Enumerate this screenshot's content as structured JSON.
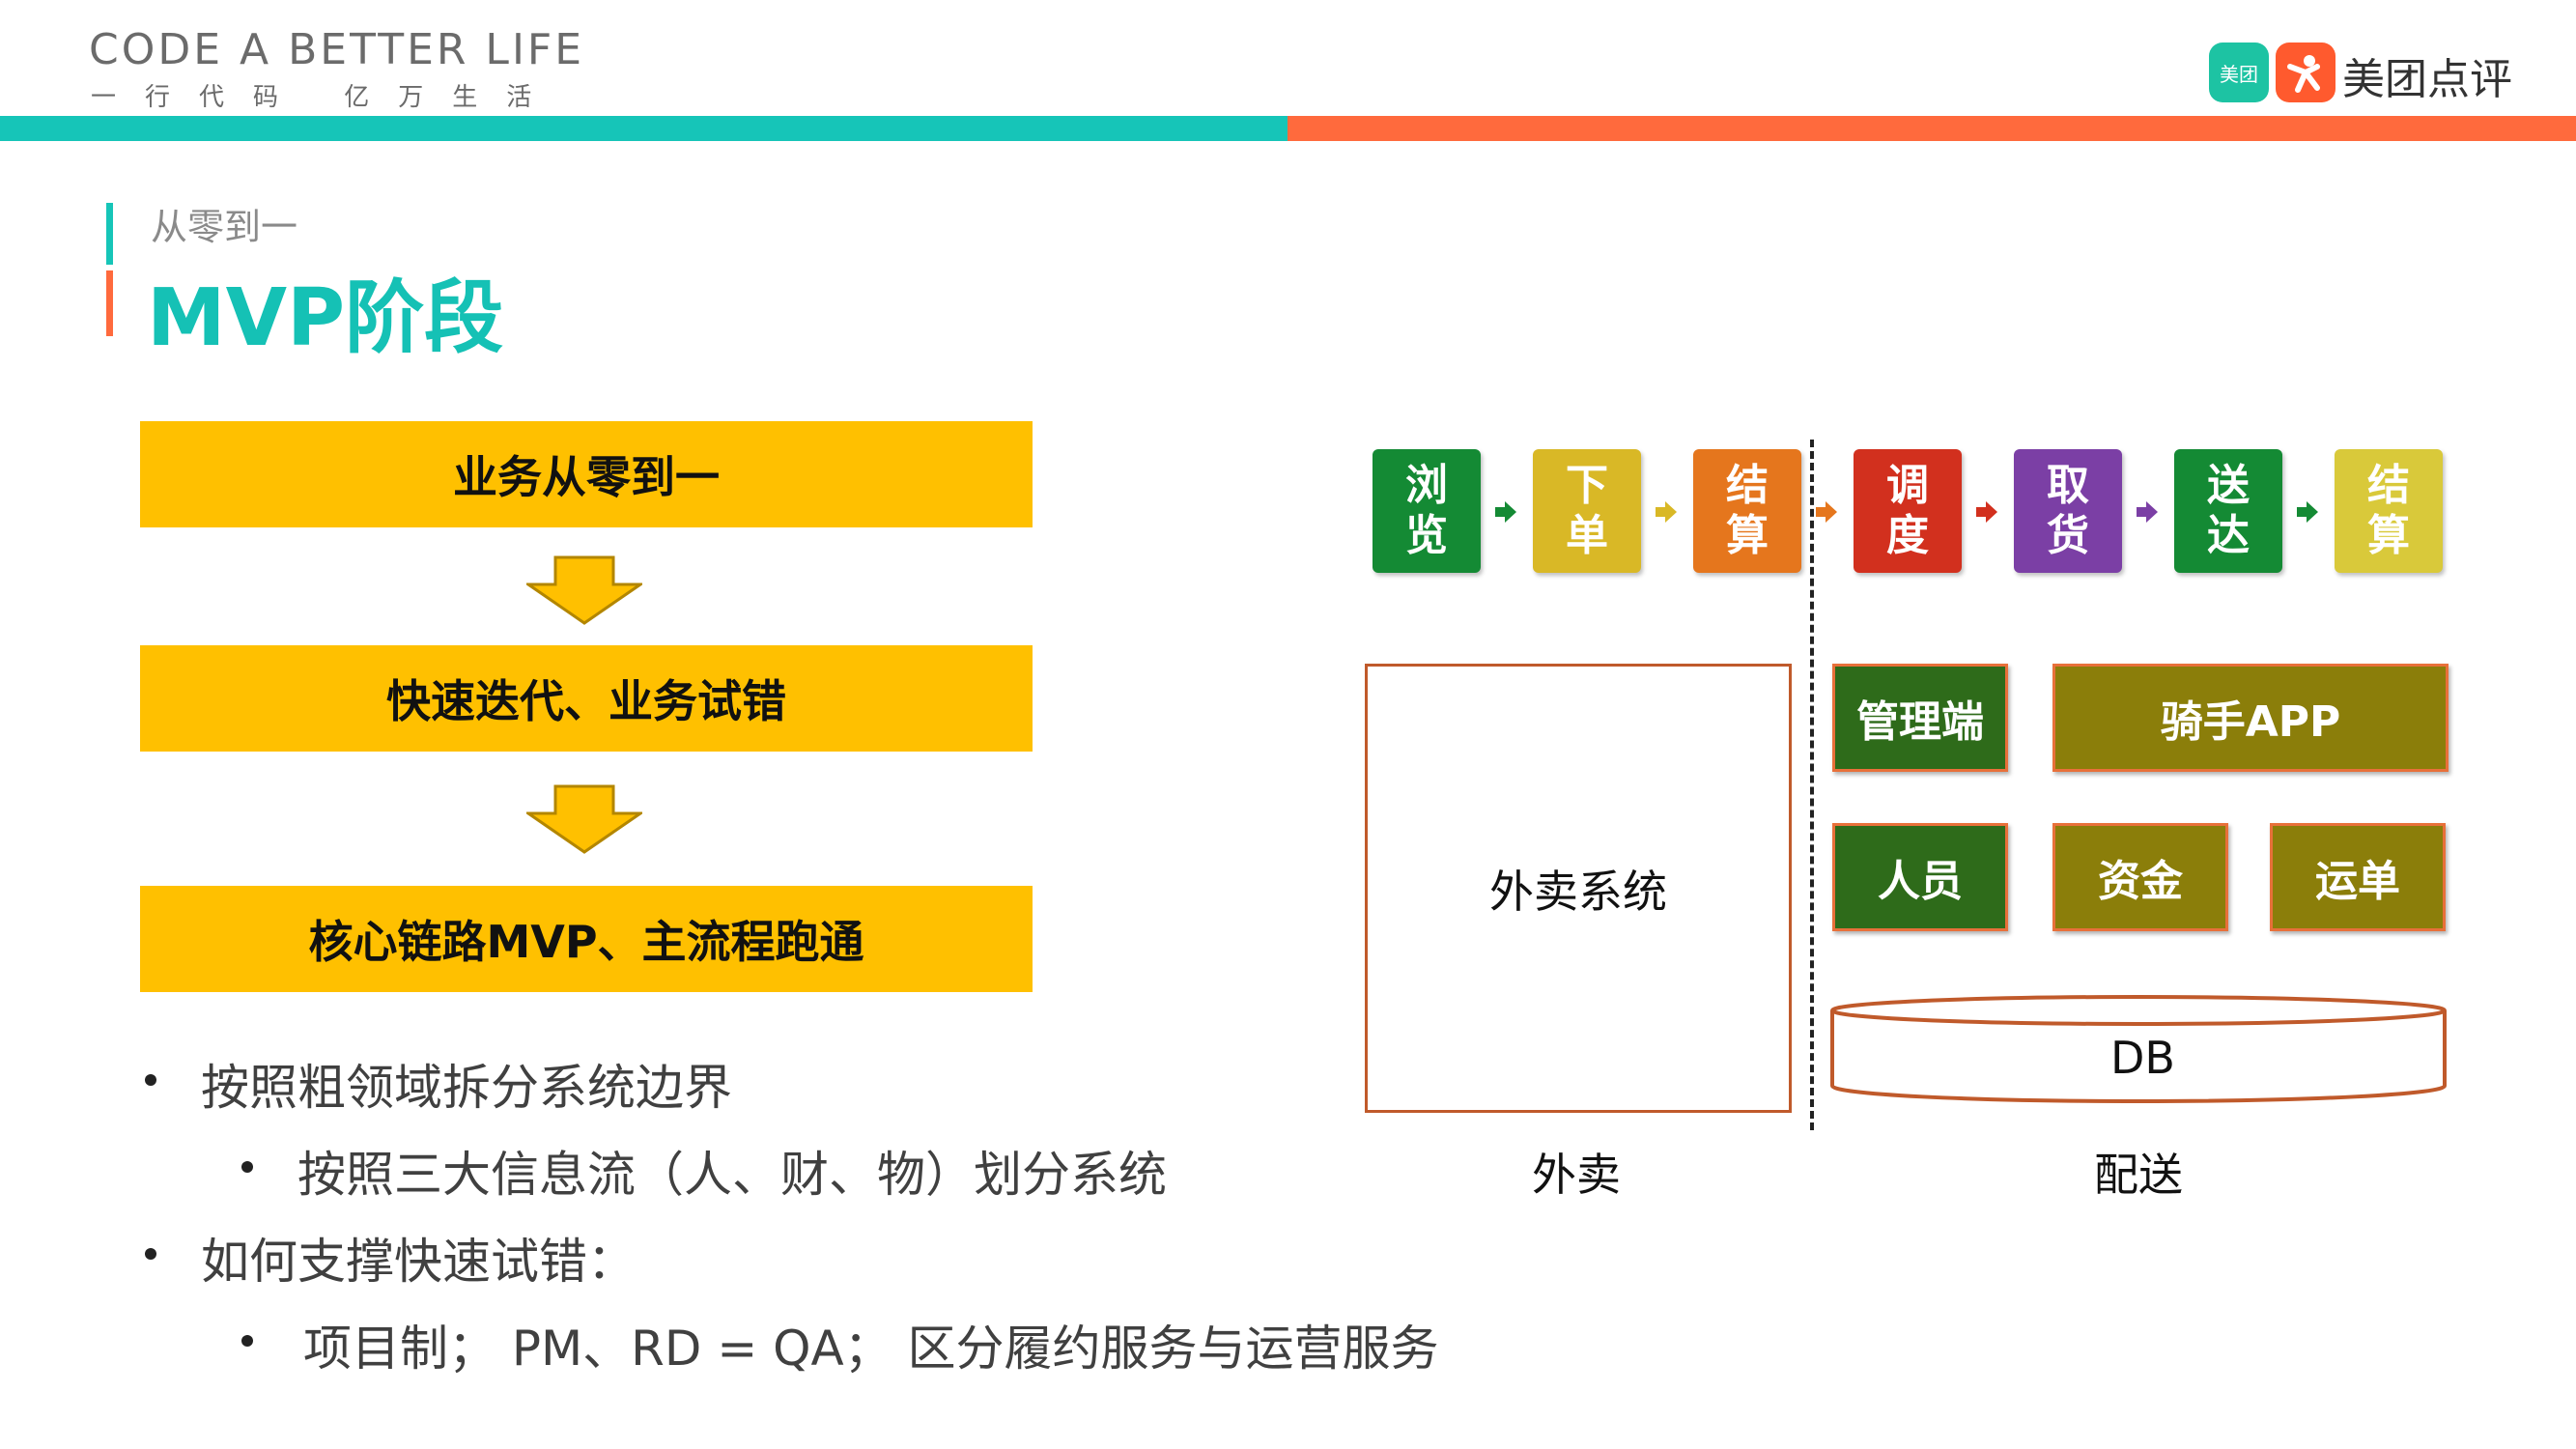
{
  "header": {
    "brand_en": "CODE A BETTER LIFE",
    "brand_cn": "一行代码 亿万生活",
    "logo_meituan": "美团",
    "logo_text": "美团点评"
  },
  "section": {
    "subtitle": "从零到一",
    "title": "MVP阶段"
  },
  "flow": {
    "steps": [
      "业务从零到一",
      "快速迭代、业务试错",
      "核心链路MVP、主流程跑通"
    ]
  },
  "bullets": [
    {
      "level": 1,
      "text": "按照粗领域拆分系统边界"
    },
    {
      "level": 2,
      "text": "按照三大信息流（人、财、物）划分系统"
    },
    {
      "level": 1,
      "text": "如何支撑快速试错："
    },
    {
      "level": 2,
      "text": "项目制； PM、RD = QA； 区分履约服务与运营服务"
    }
  ],
  "process": {
    "steps": [
      {
        "top": "浏",
        "bottom": "览",
        "color": "#148a34"
      },
      {
        "top": "下",
        "bottom": "单",
        "color": "#d9b826"
      },
      {
        "top": "结",
        "bottom": "算",
        "color": "#e5761d"
      },
      {
        "top": "调",
        "bottom": "度",
        "color": "#d2301e"
      },
      {
        "top": "取",
        "bottom": "货",
        "color": "#7b3fa5"
      },
      {
        "top": "送",
        "bottom": "达",
        "color": "#148a34"
      },
      {
        "top": "结",
        "bottom": "算",
        "color": "#d9c93a"
      }
    ]
  },
  "diagram": {
    "waimai_system": "外卖系统",
    "modules_row1": [
      "管理端",
      "骑手APP"
    ],
    "modules_row2": [
      "人员",
      "资金",
      "运单"
    ],
    "db": "DB",
    "caption_left": "外卖",
    "caption_right": "配送"
  }
}
